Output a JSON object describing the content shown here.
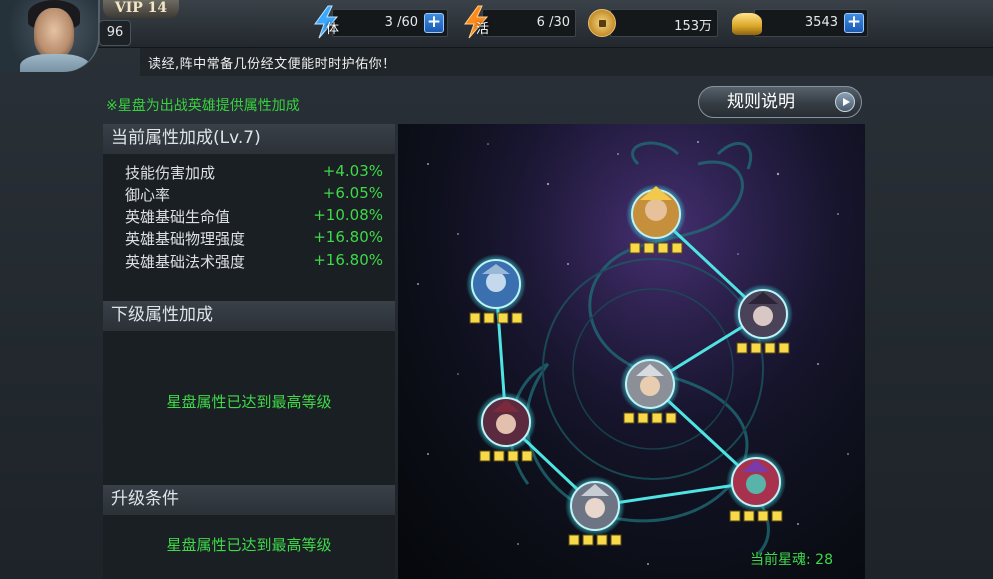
{
  "header": {
    "vip_label": "VIP 14",
    "player_level": "96",
    "stamina": {
      "icon_label": "体",
      "value": "3 /60"
    },
    "vitality": {
      "icon_label": "活",
      "value": "6 /30"
    },
    "coins": {
      "value": "153万"
    },
    "ingots": {
      "value": "3543"
    },
    "plus_symbol": "+",
    "ticker": "读经,阵中常备几份经文便能时时护佑你！"
  },
  "main": {
    "hint": "※星盘为出战英雄提供属性加成",
    "rules_button": "规则说明",
    "current_section": {
      "title": "当前属性加成(Lv.7)",
      "stats": [
        {
          "name": "技能伤害加成",
          "value": "+4.03%"
        },
        {
          "name": "御心率",
          "value": "+6.05%"
        },
        {
          "name": "英雄基础生命值",
          "value": "+10.08%"
        },
        {
          "name": "英雄基础物理强度",
          "value": "+16.80%"
        },
        {
          "name": "英雄基础法术强度",
          "value": "+16.80%"
        }
      ]
    },
    "next_section": {
      "title": "下级属性加成",
      "message": "星盘属性已达到最高等级"
    },
    "upgrade_section": {
      "title": "升级条件",
      "message": "星盘属性已达到最高等级"
    },
    "star_soul": "当前星魂: 28",
    "star_nodes": [
      {
        "name": "top",
        "stars": 4
      },
      {
        "name": "upper-left",
        "stars": 4
      },
      {
        "name": "upper-right",
        "stars": 4
      },
      {
        "name": "center",
        "stars": 4
      },
      {
        "name": "left",
        "stars": 4
      },
      {
        "name": "lower-right",
        "stars": 4
      },
      {
        "name": "bottom",
        "stars": 4
      }
    ]
  },
  "colors": {
    "accent_green": "#3fd94a",
    "link_cyan": "#4fe3e3",
    "star_gold": "#f7d94a"
  }
}
